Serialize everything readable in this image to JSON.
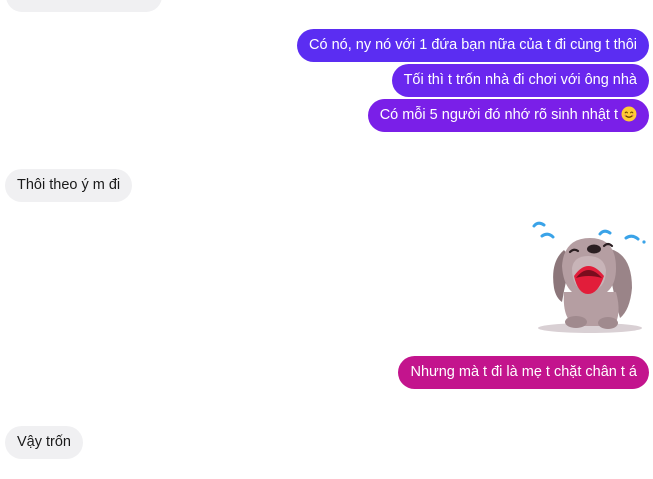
{
  "messages": [
    {
      "id": "m1",
      "direction": "outgoing",
      "text": "Có nó, ny nó với 1 đứa bạn nữa của t đi cùng t thôi"
    },
    {
      "id": "m2",
      "direction": "outgoing",
      "text": "Tối thì t trốn nhà đi chơi với ông nhà"
    },
    {
      "id": "m3",
      "direction": "outgoing",
      "text": "Có mỗi 5 người đó nhớ rõ sinh nhật t",
      "emoji": "smiling-face-icon"
    },
    {
      "id": "m4",
      "direction": "incoming",
      "text": "Thôi theo ý m đi"
    },
    {
      "id": "m5",
      "direction": "outgoing",
      "type": "sticker",
      "sticker": "crying-dog-sticker"
    },
    {
      "id": "m6",
      "direction": "outgoing",
      "text": "Nhưng mà t đi là mẹ t chặt chân t á"
    },
    {
      "id": "m7",
      "direction": "incoming",
      "text": "Vậy trốn"
    }
  ],
  "colors": {
    "outgoing_gradient": [
      "#5b2df2",
      "#6a27ef",
      "#7a1fe8",
      "#c3148d"
    ],
    "incoming_bg": "#f0f0f2"
  }
}
